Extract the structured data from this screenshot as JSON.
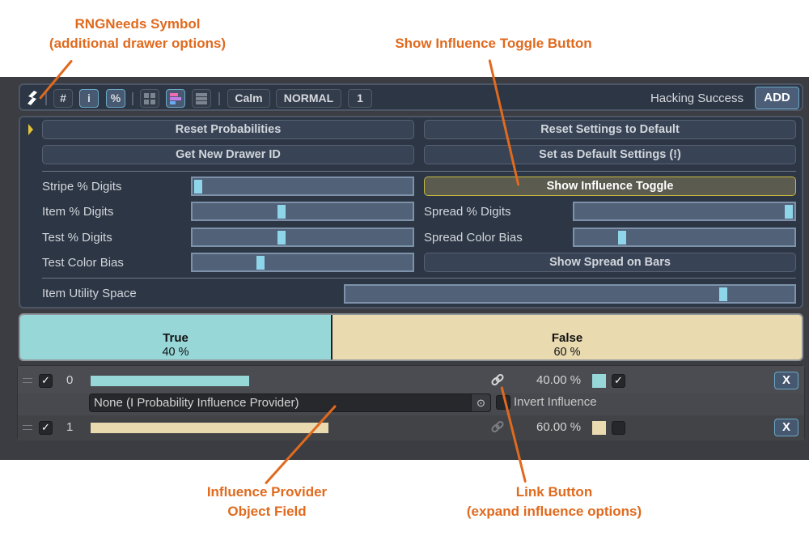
{
  "annotations": {
    "rngneeds_symbol": [
      "RNGNeeds Symbol",
      "(additional drawer options)"
    ],
    "show_influence_toggle": "Show Influence Toggle Button",
    "influence_provider": [
      "Influence Provider",
      "Object Field"
    ],
    "link_button": [
      "Link Button",
      "(expand influence options)"
    ]
  },
  "toolbar": {
    "logo_icon": "rngneeds-logo-icon",
    "hash_label": "#",
    "info_label": "i",
    "percent_label": "%",
    "view_grid_icon": "grid-view-icon",
    "view_stripe_icon": "stripe-view-icon",
    "view_list_icon": "list-view-icon",
    "palette_label": "Calm",
    "mode_label": "NORMAL",
    "pick_count": "1",
    "list_name": "Hacking Success",
    "add_label": "ADD"
  },
  "settings": {
    "reset_probabilities": "Reset Probabilities",
    "reset_settings": "Reset Settings to Default",
    "get_drawer_id": "Get New Drawer ID",
    "set_default": "Set as Default Settings (!)",
    "show_influence_toggle": "Show Influence Toggle",
    "show_spread_on_bars": "Show Spread on Bars",
    "sliders": {
      "stripe_digits": {
        "label": "Stripe % Digits",
        "value": 0.0
      },
      "item_digits": {
        "label": "Item % Digits",
        "value": 0.4
      },
      "test_digits": {
        "label": "Test % Digits",
        "value": 0.4
      },
      "test_color_bias": {
        "label": "Test Color Bias",
        "value": 0.3
      },
      "spread_digits": {
        "label": "Spread % Digits",
        "value": 1.0
      },
      "spread_color_bias": {
        "label": "Spread Color Bias",
        "value": 0.2
      },
      "item_utility_space": {
        "label": "Item Utility Space",
        "value": 0.85
      }
    }
  },
  "stripe": [
    {
      "name": "True",
      "percent_label": "40 %",
      "share": 0.4,
      "color": "#98d7d8"
    },
    {
      "name": "False",
      "percent_label": "60 %",
      "share": 0.6,
      "color": "#e9dab0"
    }
  ],
  "items": [
    {
      "index": "0",
      "enabled": true,
      "probability": "40.00 %",
      "bar_fill": 0.4,
      "color": "#98d7d8",
      "locked": true,
      "remove_label": "X"
    },
    {
      "index": "1",
      "enabled": true,
      "probability": "60.00 %",
      "bar_fill": 0.6,
      "color": "#e9dab0",
      "locked": false,
      "remove_label": "X"
    }
  ],
  "influence": {
    "provider_field": "None (I Probability Influence Provider)",
    "invert_label": "Invert Influence",
    "invert_checked": false
  }
}
